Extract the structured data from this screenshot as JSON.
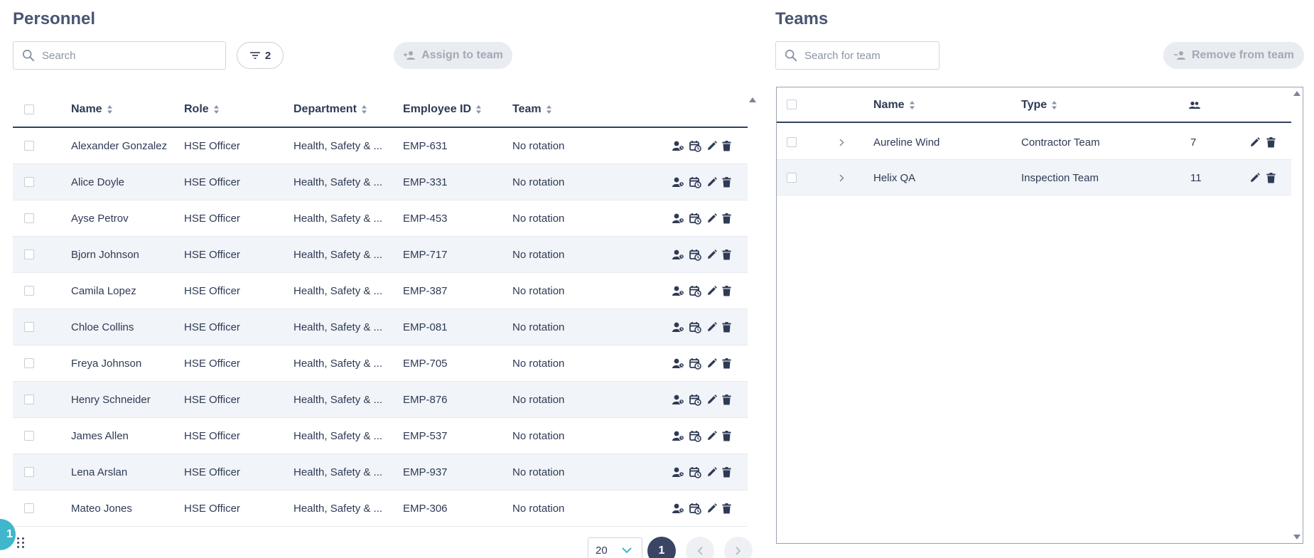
{
  "personnel": {
    "title": "Personnel",
    "search_placeholder": "Search",
    "filter_count": "2",
    "assign_label": "Assign to team",
    "columns": [
      "Name",
      "Role",
      "Department",
      "Employee ID",
      "Team"
    ],
    "rows": [
      {
        "name": "Alexander Gonzalez",
        "role": "HSE Officer",
        "department": "Health, Safety & ...",
        "employee_id": "EMP-631",
        "team": "No rotation"
      },
      {
        "name": "Alice Doyle",
        "role": "HSE Officer",
        "department": "Health, Safety & ...",
        "employee_id": "EMP-331",
        "team": "No rotation"
      },
      {
        "name": "Ayse Petrov",
        "role": "HSE Officer",
        "department": "Health, Safety & ...",
        "employee_id": "EMP-453",
        "team": "No rotation"
      },
      {
        "name": "Bjorn Johnson",
        "role": "HSE Officer",
        "department": "Health, Safety & ...",
        "employee_id": "EMP-717",
        "team": "No rotation"
      },
      {
        "name": "Camila Lopez",
        "role": "HSE Officer",
        "department": "Health, Safety & ...",
        "employee_id": "EMP-387",
        "team": "No rotation"
      },
      {
        "name": "Chloe Collins",
        "role": "HSE Officer",
        "department": "Health, Safety & ...",
        "employee_id": "EMP-081",
        "team": "No rotation"
      },
      {
        "name": "Freya Johnson",
        "role": "HSE Officer",
        "department": "Health, Safety & ...",
        "employee_id": "EMP-705",
        "team": "No rotation"
      },
      {
        "name": "Henry Schneider",
        "role": "HSE Officer",
        "department": "Health, Safety & ...",
        "employee_id": "EMP-876",
        "team": "No rotation"
      },
      {
        "name": "James Allen",
        "role": "HSE Officer",
        "department": "Health, Safety & ...",
        "employee_id": "EMP-537",
        "team": "No rotation"
      },
      {
        "name": "Lena Arslan",
        "role": "HSE Officer",
        "department": "Health, Safety & ...",
        "employee_id": "EMP-937",
        "team": "No rotation"
      },
      {
        "name": "Mateo Jones",
        "role": "HSE Officer",
        "department": "Health, Safety & ...",
        "employee_id": "EMP-306",
        "team": "No rotation"
      }
    ]
  },
  "pagination": {
    "page_size": "20",
    "current_page": "1"
  },
  "teams": {
    "title": "Teams",
    "search_placeholder": "Search for team",
    "remove_label": "Remove from team",
    "columns": [
      "Name",
      "Type"
    ],
    "rows": [
      {
        "name": "Aureline Wind",
        "type": "Contractor Team",
        "members": "7"
      },
      {
        "name": "Helix QA",
        "type": "Inspection Team",
        "members": "11"
      }
    ]
  },
  "fab_label": "1",
  "colors": {
    "accent": "#3a4566",
    "fab": "#3fb6cc",
    "row_alt": "#f1f4f8"
  }
}
